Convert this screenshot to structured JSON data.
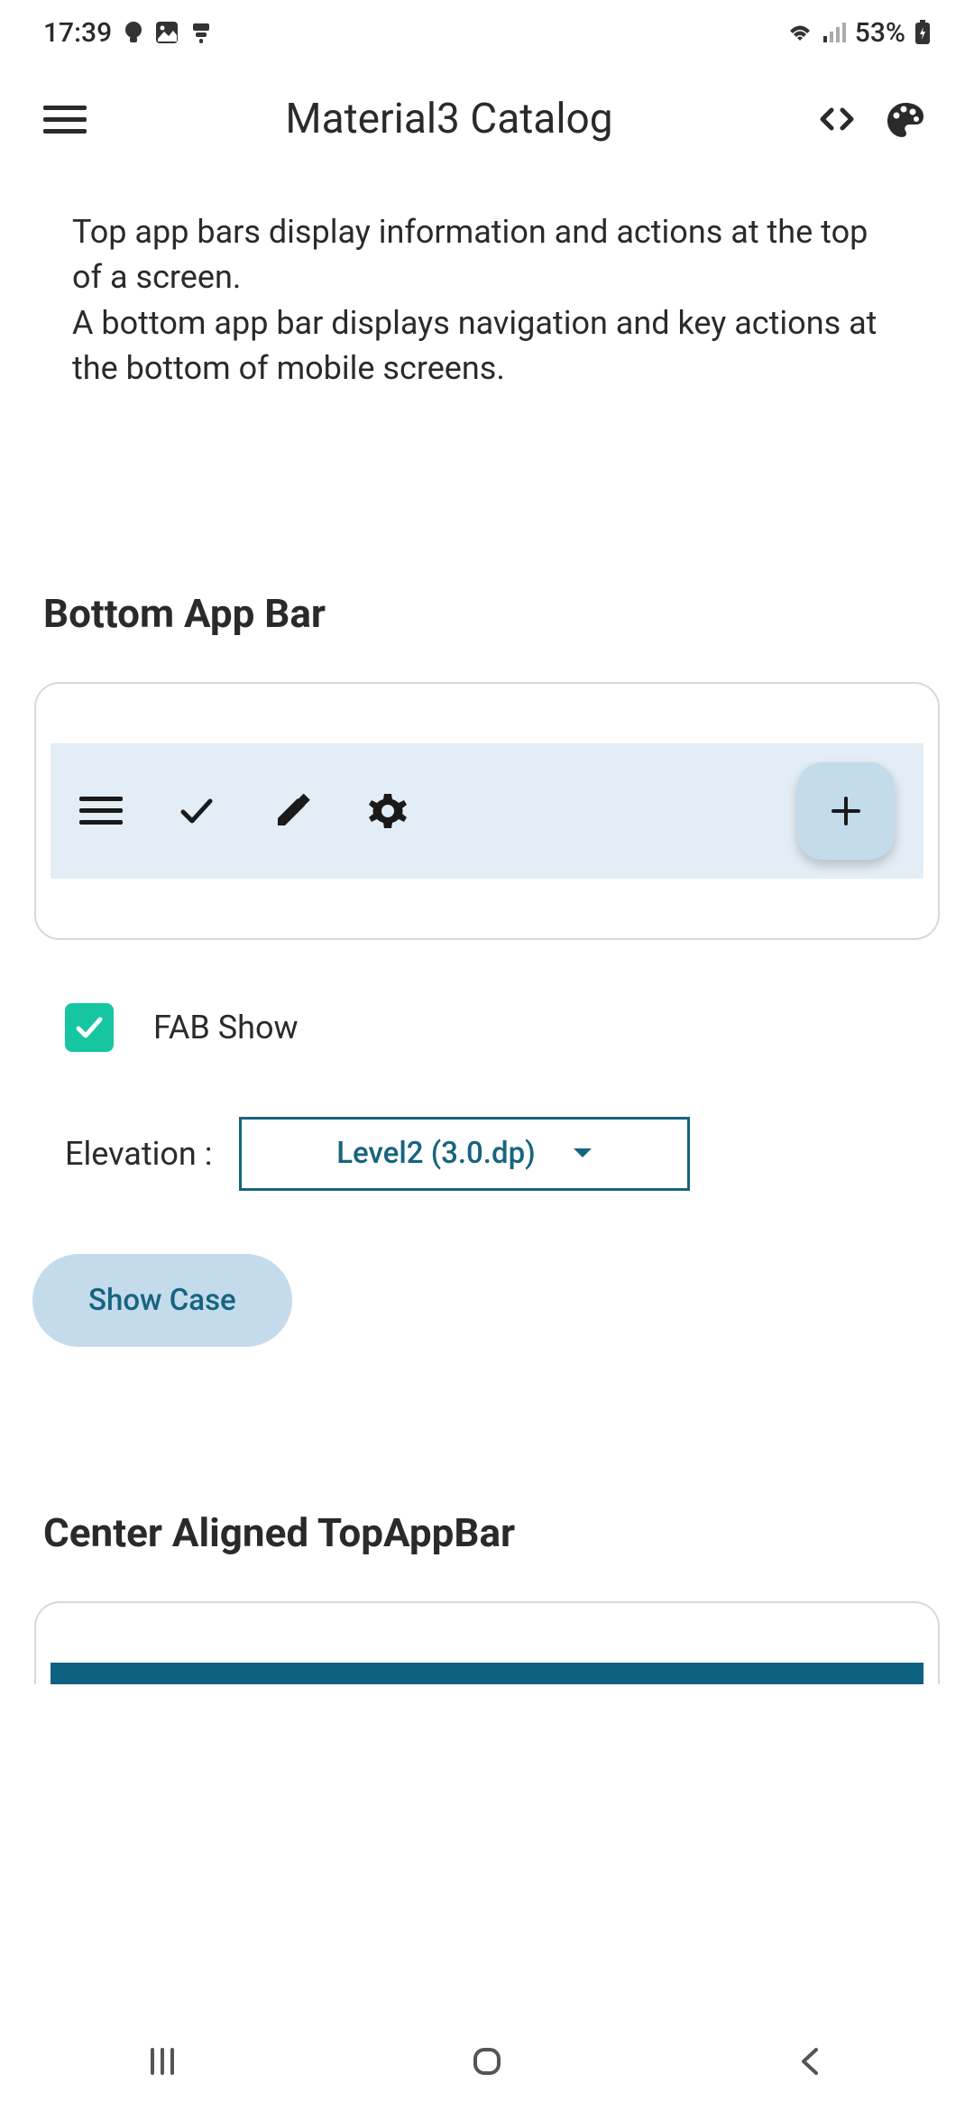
{
  "status": {
    "time": "17:39",
    "battery": "53%"
  },
  "appbar": {
    "title": "Material3 Catalog"
  },
  "description": {
    "line1": "Top app bars display information and actions at the top of a screen.",
    "line2": "A bottom app bar displays navigation and key actions at the bottom of mobile screens."
  },
  "section1": {
    "title": "Bottom App Bar",
    "fab_label": "FAB Show",
    "elevation_label": "Elevation :",
    "elevation_value": "Level2 (3.0.dp)",
    "showcase_button": "Show Case"
  },
  "section2": {
    "title": "Center Aligned TopAppBar"
  },
  "colors": {
    "accent": "#16647f",
    "teal_check": "#16c6a2",
    "surface_blue": "#e3edf5",
    "fab_blue": "#c4dbec"
  }
}
